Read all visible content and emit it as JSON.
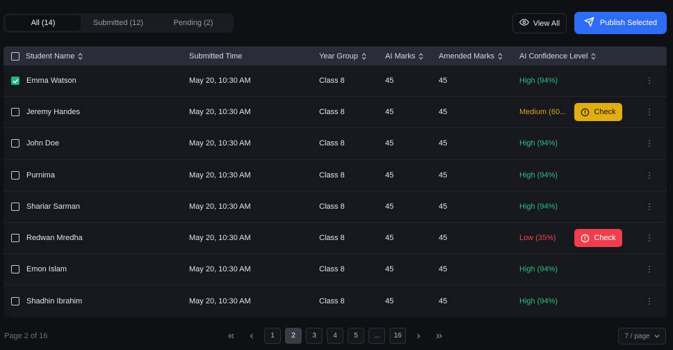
{
  "tabs": [
    {
      "label": "All (14)",
      "active": true
    },
    {
      "label": "Submitted (12)",
      "active": false
    },
    {
      "label": "Pending (2)",
      "active": false
    }
  ],
  "actions": {
    "view_all_label": "View All",
    "publish_label": "Publish Selected"
  },
  "table": {
    "headers": {
      "student_name": "Student Name",
      "submitted_time": "Submitted Time",
      "year_group": "Year Group",
      "ai_marks": "AI Marks",
      "amended_marks": "Amended Marks",
      "ai_confidence": "AI Confidence Level"
    },
    "rows": [
      {
        "checked": true,
        "name": "Emma Watson",
        "time": "May 20, 10:30 AM",
        "year": "Class 8",
        "ai_marks": "45",
        "amended": "45",
        "confidence": "High (94%)",
        "level": "high",
        "check_label": ""
      },
      {
        "checked": false,
        "name": "Jeremy Handes",
        "time": "May 20, 10:30 AM",
        "year": "Class 8",
        "ai_marks": "45",
        "amended": "45",
        "confidence": "Medium (60...",
        "level": "medium",
        "check_label": "Check"
      },
      {
        "checked": false,
        "name": "John Doe",
        "time": "May 20, 10:30 AM",
        "year": "Class 8",
        "ai_marks": "45",
        "amended": "45",
        "confidence": "High (94%)",
        "level": "high",
        "check_label": ""
      },
      {
        "checked": false,
        "name": "Purnima",
        "time": "May 20, 10:30 AM",
        "year": "Class 8",
        "ai_marks": "45",
        "amended": "45",
        "confidence": "High (94%)",
        "level": "high",
        "check_label": ""
      },
      {
        "checked": false,
        "name": "Shariar Sarman",
        "time": "May 20, 10:30 AM",
        "year": "Class 8",
        "ai_marks": "45",
        "amended": "45",
        "confidence": "High (94%)",
        "level": "high",
        "check_label": ""
      },
      {
        "checked": false,
        "name": "Redwan Mredha",
        "time": "May 20, 10:30 AM",
        "year": "Class 8",
        "ai_marks": "45",
        "amended": "45",
        "confidence": "Low (35%)",
        "level": "low",
        "check_label": "Check"
      },
      {
        "checked": false,
        "name": "Emon Islam",
        "time": "May 20, 10:30 AM",
        "year": "Class 8",
        "ai_marks": "45",
        "amended": "45",
        "confidence": "High (94%)",
        "level": "high",
        "check_label": ""
      },
      {
        "checked": false,
        "name": "Shadhin Ibrahim",
        "time": "May 20, 10:30 AM",
        "year": "Class 8",
        "ai_marks": "45",
        "amended": "45",
        "confidence": "High (94%)",
        "level": "high",
        "check_label": ""
      }
    ]
  },
  "footer": {
    "page_info": "Page 2 of 16",
    "pages": [
      "1",
      "2",
      "3",
      "4",
      "5",
      "...",
      "16"
    ],
    "active_page": "2",
    "per_page": "7 / page"
  },
  "colors": {
    "accent": "#2f6cf6",
    "high": "#2bbd82",
    "medium": "#d6a51c",
    "low": "#ef4452"
  }
}
